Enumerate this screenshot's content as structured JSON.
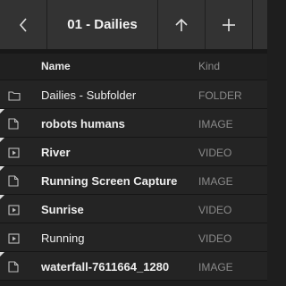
{
  "toolbar": {
    "back_icon": "chevron-left-icon",
    "title": "01 - Dailies",
    "sort_icon": "arrow-up-icon",
    "add_icon": "plus-icon"
  },
  "columns": {
    "name": "Name",
    "kind": "Kind"
  },
  "items": [
    {
      "name": "Dailies - Subfolder",
      "kind": "FOLDER",
      "icon": "folder-icon",
      "bold": false,
      "marked": false
    },
    {
      "name": "robots humans",
      "kind": "IMAGE",
      "icon": "image-file-icon",
      "bold": true,
      "marked": true
    },
    {
      "name": "River",
      "kind": "VIDEO",
      "icon": "video-file-icon",
      "bold": true,
      "marked": true
    },
    {
      "name": "Running Screen Capture",
      "kind": "IMAGE",
      "icon": "image-file-icon",
      "bold": true,
      "marked": true
    },
    {
      "name": "Sunrise",
      "kind": "VIDEO",
      "icon": "video-file-icon",
      "bold": true,
      "marked": true
    },
    {
      "name": "Running",
      "kind": "VIDEO",
      "icon": "video-file-icon",
      "bold": false,
      "marked": false
    },
    {
      "name": "waterfall-7611664_1280",
      "kind": "IMAGE",
      "icon": "image-file-icon",
      "bold": true,
      "marked": true
    }
  ]
}
